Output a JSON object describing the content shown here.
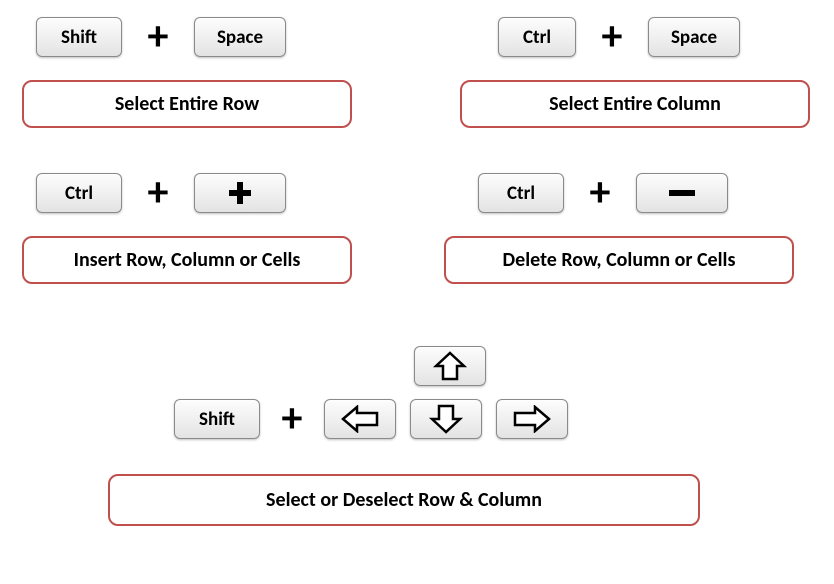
{
  "shortcuts": {
    "select_row": {
      "keys": [
        "Shift",
        "Space"
      ],
      "label": "Select Entire Row"
    },
    "select_column": {
      "keys": [
        "Ctrl",
        "Space"
      ],
      "label": "Select Entire Column"
    },
    "insert": {
      "keys": [
        "Ctrl",
        "+"
      ],
      "label": "Insert Row, Column or Cells"
    },
    "delete": {
      "keys": [
        "Ctrl",
        "−"
      ],
      "label": "Delete Row, Column or Cells"
    },
    "select_deselect": {
      "keys": [
        "Shift"
      ],
      "label": "Select or Deselect Row & Column"
    }
  }
}
